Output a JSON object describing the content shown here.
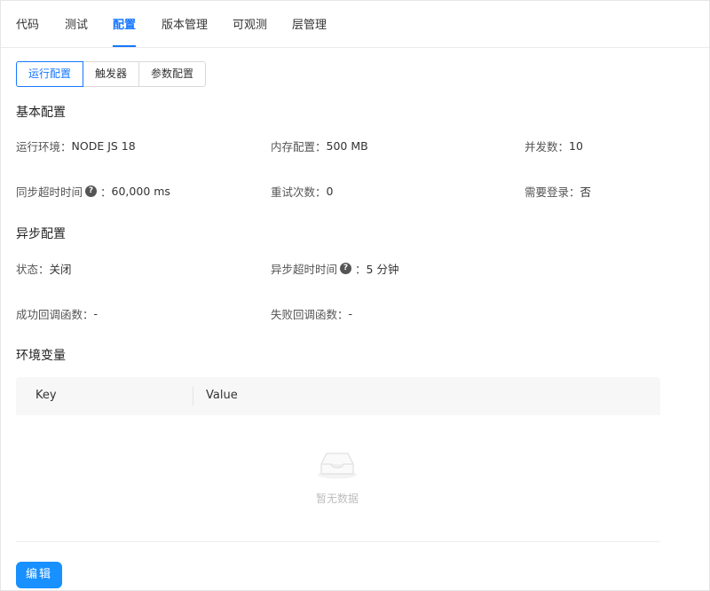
{
  "top_tabs": {
    "items": [
      {
        "label": "代码"
      },
      {
        "label": "测试"
      },
      {
        "label": "配置"
      },
      {
        "label": "版本管理"
      },
      {
        "label": "可观测"
      },
      {
        "label": "层管理"
      }
    ],
    "active": "配置"
  },
  "sub_tabs": {
    "items": [
      {
        "label": "运行配置"
      },
      {
        "label": "触发器"
      },
      {
        "label": "参数配置"
      }
    ],
    "active": "运行配置"
  },
  "basic": {
    "title": "基本配置",
    "runtime": {
      "label": "运行环境：",
      "value": "NODE JS 18"
    },
    "memory": {
      "label": "内存配置：",
      "value": "500 MB"
    },
    "concurrency": {
      "label": "并发数：",
      "value": "10"
    },
    "sync_timeout": {
      "label": "同步超时时间",
      "colon": "：",
      "value": "60,000  ms"
    },
    "retries": {
      "label": "重试次数：",
      "value": "0"
    },
    "login_required": {
      "label": "需要登录：",
      "value": "否"
    }
  },
  "async": {
    "title": "异步配置",
    "status": {
      "label": "状态：",
      "value": "关闭"
    },
    "timeout": {
      "label": "异步超时时间",
      "colon": "：",
      "value": "5  分钟"
    },
    "success_callback": {
      "label": "成功回调函数：",
      "value": "-"
    },
    "failure_callback": {
      "label": "失败回调函数：",
      "value": "-"
    }
  },
  "env": {
    "title": "环境变量",
    "columns": [
      "Key",
      "Value"
    ],
    "empty_text": "暂无数据"
  },
  "edit_button": {
    "label": "编辑"
  },
  "colors": {
    "accent": "#1677ff",
    "button": "#1890ff"
  }
}
